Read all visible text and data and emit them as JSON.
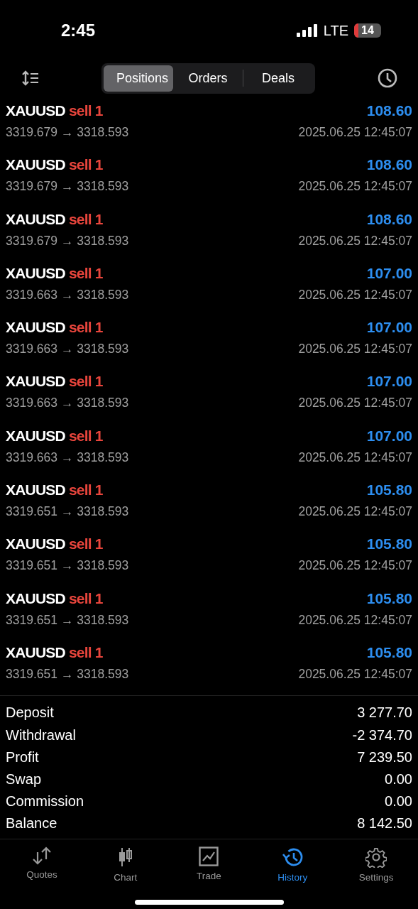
{
  "status_bar": {
    "time": "2:45",
    "network": "LTE",
    "battery": "14"
  },
  "segments": [
    {
      "label": "Positions",
      "selected": true
    },
    {
      "label": "Orders",
      "selected": false
    },
    {
      "label": "Deals",
      "selected": false
    }
  ],
  "deals": [
    {
      "symbol": "XAUUSD",
      "side": "sell 1",
      "profit": "108.60",
      "prices": "3319.679 → 3318.593",
      "time": "2025.06.25 12:45:07"
    },
    {
      "symbol": "XAUUSD",
      "side": "sell 1",
      "profit": "108.60",
      "prices": "3319.679 → 3318.593",
      "time": "2025.06.25 12:45:07"
    },
    {
      "symbol": "XAUUSD",
      "side": "sell 1",
      "profit": "108.60",
      "prices": "3319.679 → 3318.593",
      "time": "2025.06.25 12:45:07"
    },
    {
      "symbol": "XAUUSD",
      "side": "sell 1",
      "profit": "107.00",
      "prices": "3319.663 → 3318.593",
      "time": "2025.06.25 12:45:07"
    },
    {
      "symbol": "XAUUSD",
      "side": "sell 1",
      "profit": "107.00",
      "prices": "3319.663 → 3318.593",
      "time": "2025.06.25 12:45:07"
    },
    {
      "symbol": "XAUUSD",
      "side": "sell 1",
      "profit": "107.00",
      "prices": "3319.663 → 3318.593",
      "time": "2025.06.25 12:45:07"
    },
    {
      "symbol": "XAUUSD",
      "side": "sell 1",
      "profit": "107.00",
      "prices": "3319.663 → 3318.593",
      "time": "2025.06.25 12:45:07"
    },
    {
      "symbol": "XAUUSD",
      "side": "sell 1",
      "profit": "105.80",
      "prices": "3319.651 → 3318.593",
      "time": "2025.06.25 12:45:07"
    },
    {
      "symbol": "XAUUSD",
      "side": "sell 1",
      "profit": "105.80",
      "prices": "3319.651 → 3318.593",
      "time": "2025.06.25 12:45:07"
    },
    {
      "symbol": "XAUUSD",
      "side": "sell 1",
      "profit": "105.80",
      "prices": "3319.651 → 3318.593",
      "time": "2025.06.25 12:45:07"
    },
    {
      "symbol": "XAUUSD",
      "side": "sell 1",
      "profit": "105.80",
      "prices": "3319.651 → 3318.593",
      "time": "2025.06.25 12:45:07"
    }
  ],
  "summary": [
    {
      "label": "Deposit",
      "value": "3 277.70"
    },
    {
      "label": "Withdrawal",
      "value": "-2 374.70"
    },
    {
      "label": "Profit",
      "value": "7 239.50"
    },
    {
      "label": "Swap",
      "value": "0.00"
    },
    {
      "label": "Commission",
      "value": "0.00"
    },
    {
      "label": "Balance",
      "value": "8 142.50"
    }
  ],
  "tab_bar": [
    {
      "kind": "quotes",
      "label": "Quotes",
      "selected": false
    },
    {
      "kind": "chart",
      "label": "Chart",
      "selected": false
    },
    {
      "kind": "trade",
      "label": "Trade",
      "selected": false
    },
    {
      "kind": "history",
      "label": "History",
      "selected": true
    },
    {
      "kind": "settings",
      "label": "Settings",
      "selected": false
    }
  ]
}
